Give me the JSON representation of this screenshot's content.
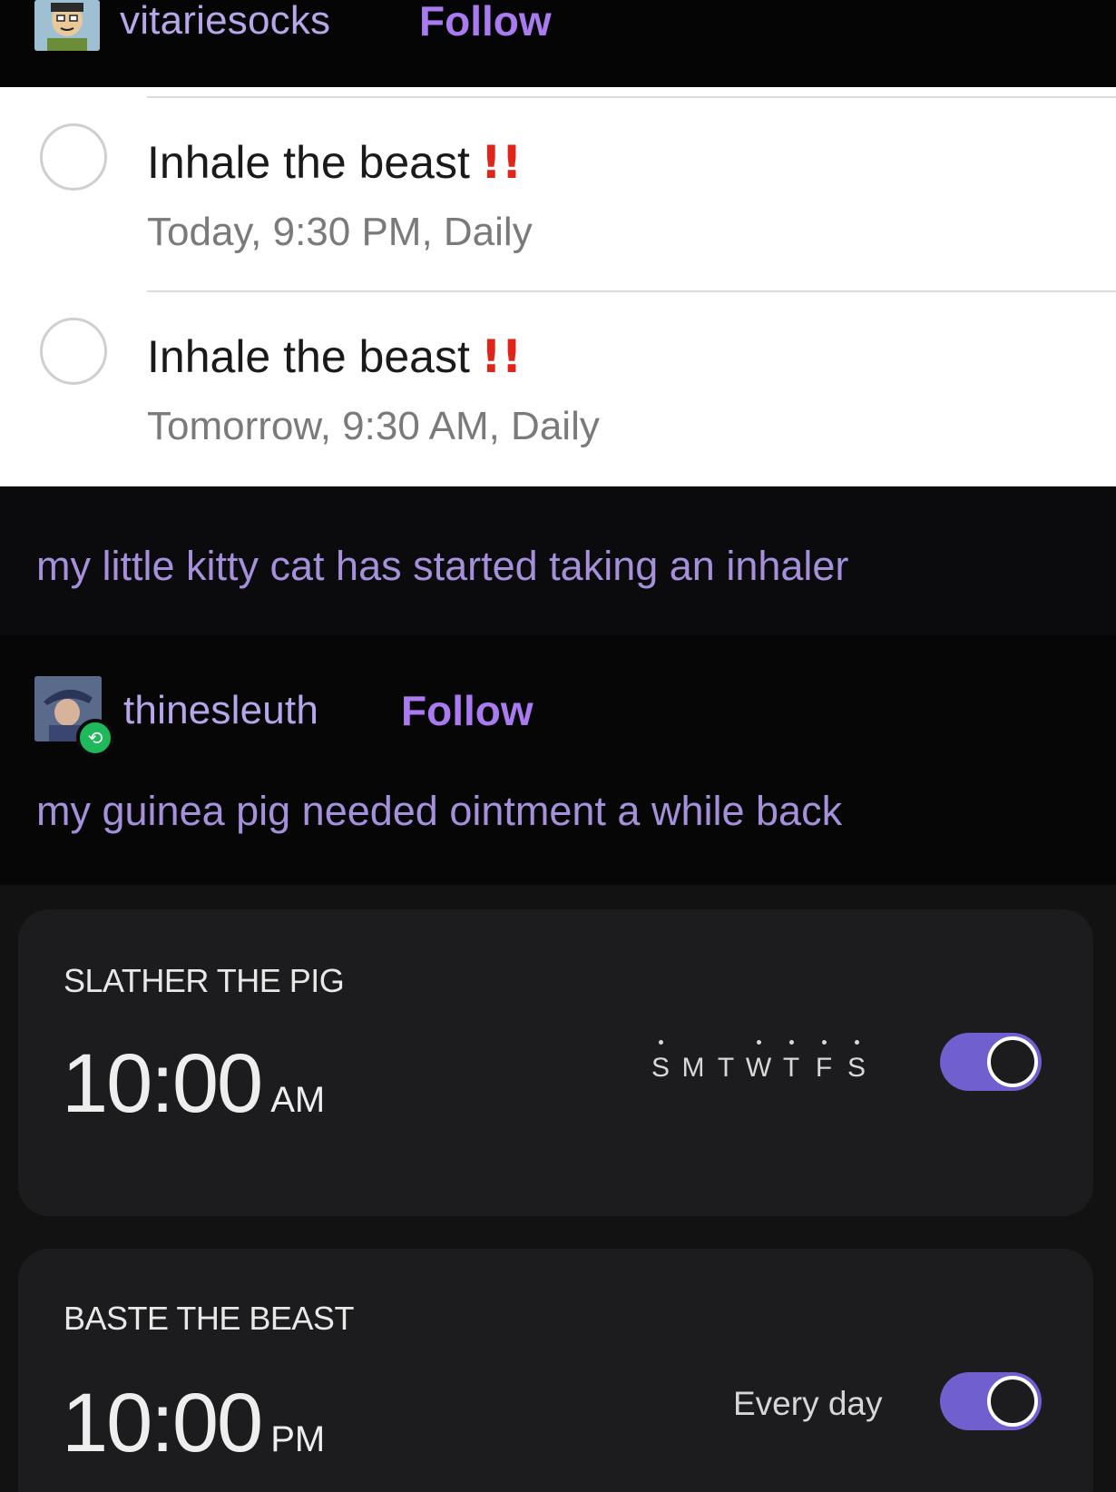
{
  "post1": {
    "username": "vitariesocks",
    "follow_label": "Follow",
    "caption": "my little kitty cat has started taking an inhaler"
  },
  "reminders": [
    {
      "title": "Inhale the beast",
      "priority_mark": "!!",
      "subtitle": "Today, 9:30 PM, Daily"
    },
    {
      "title": "Inhale the beast",
      "priority_mark": "!!",
      "subtitle": "Tomorrow, 9:30 AM, Daily"
    }
  ],
  "post2": {
    "username": "thinesleuth",
    "follow_label": "Follow",
    "caption": "my guinea pig needed ointment a while back"
  },
  "alarms": [
    {
      "label": "SLATHER THE PIG",
      "time": "10:00",
      "period": "AM",
      "days": [
        "S",
        "M",
        "T",
        "W",
        "T",
        "F",
        "S"
      ],
      "days_selected": [
        true,
        false,
        false,
        true,
        true,
        true,
        true
      ],
      "enabled": true
    },
    {
      "label": "BASTE THE BEAST",
      "time": "10:00",
      "period": "PM",
      "repeat": "Every day",
      "enabled": true
    }
  ],
  "colors": {
    "accent": "#6f5fcf",
    "follow": "#a97af0",
    "priority": "#e0241a",
    "reblog": "#1fb85a"
  },
  "icons": {
    "reblog_badge": "reblog-icon",
    "checkbox": "circle-checkbox-icon"
  }
}
